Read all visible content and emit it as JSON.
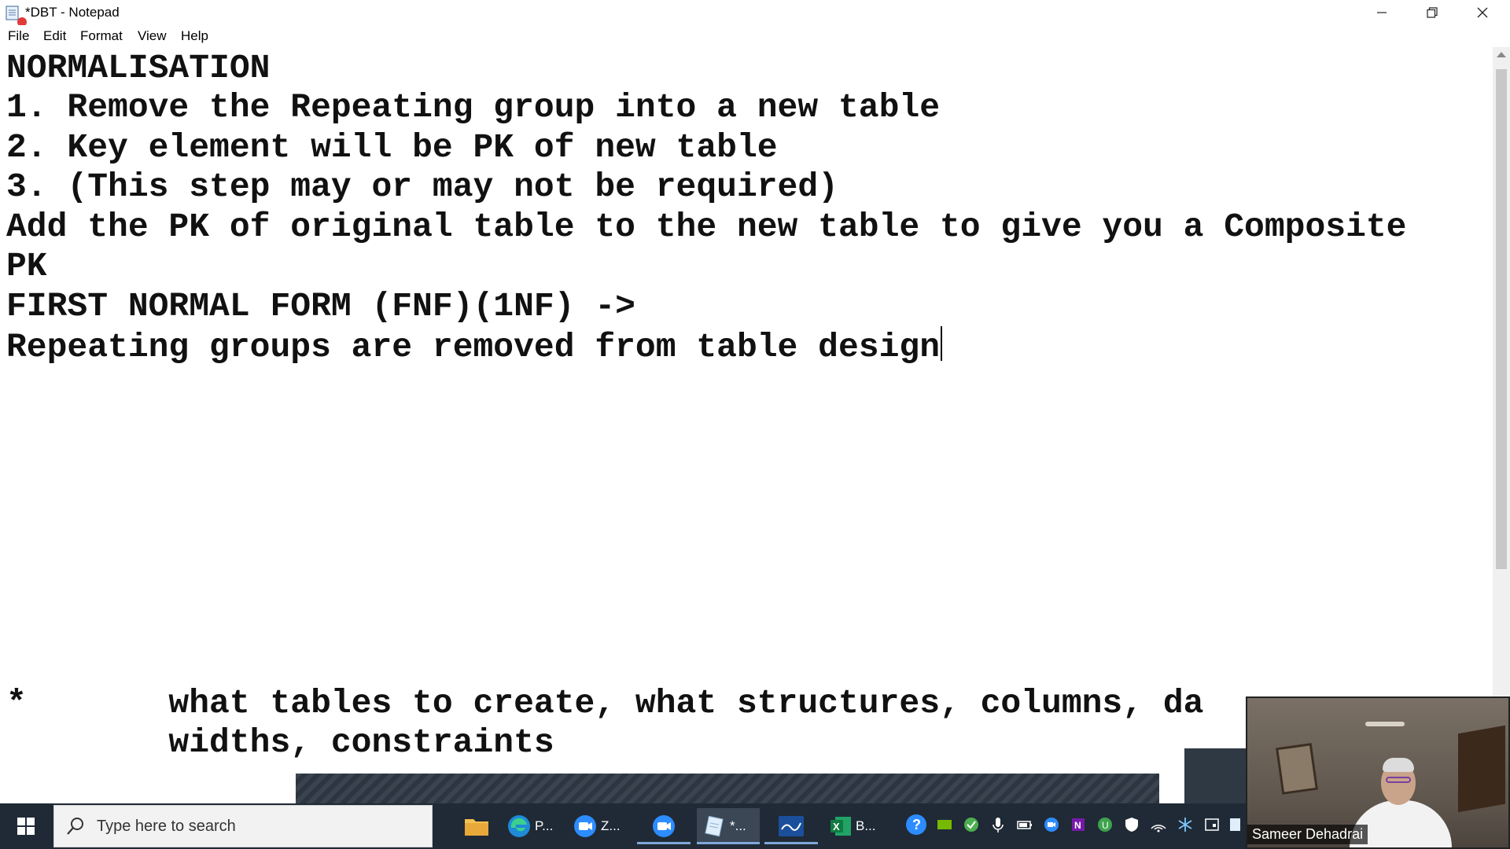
{
  "window": {
    "title": "*DBT - Notepad",
    "minimize_glyph": "—",
    "maximize_glyph": "❐",
    "close_glyph": "✕"
  },
  "menu": [
    {
      "underline": "F",
      "rest": "ile"
    },
    {
      "underline": "E",
      "rest": "dit"
    },
    {
      "underline": "",
      "pre": "F",
      "mid": "o",
      "rest": "rmat"
    },
    {
      "underline": "V",
      "rest": "iew"
    },
    {
      "underline": "H",
      "rest": "elp"
    }
  ],
  "menu_labels": [
    "File",
    "Edit",
    "Format",
    "View",
    "Help"
  ],
  "document": {
    "lines": [
      "NORMALISATION",
      "1. Remove the Repeating group into a new table",
      "2. Key element will be PK of new table",
      "3. (This step may or may not be required)",
      "Add the PK of original table to the new table to give you a Composite",
      "PK",
      "FIRST NORMAL FORM (FNF)(1NF) ->",
      "Repeating groups are removed from table design"
    ],
    "lower_lines": [
      "*       what tables to create, what structures, columns, da",
      "        widths, constraints"
    ]
  },
  "video": {
    "participant_name": "Sameer Dehadrai"
  },
  "taskbar": {
    "search_placeholder": "Type here to search",
    "apps": [
      {
        "name": "file-explorer",
        "label": ""
      },
      {
        "name": "edge",
        "label": "P..."
      },
      {
        "name": "zoom",
        "label": "Z..."
      },
      {
        "name": "zoom-meeting",
        "label": ""
      },
      {
        "name": "notepad",
        "label": "*..."
      },
      {
        "name": "whiteboard",
        "label": ""
      },
      {
        "name": "excel",
        "label": "B..."
      }
    ]
  },
  "colors": {
    "taskbar_bg": "#1f2a36",
    "accent": "#7fa7d9"
  }
}
